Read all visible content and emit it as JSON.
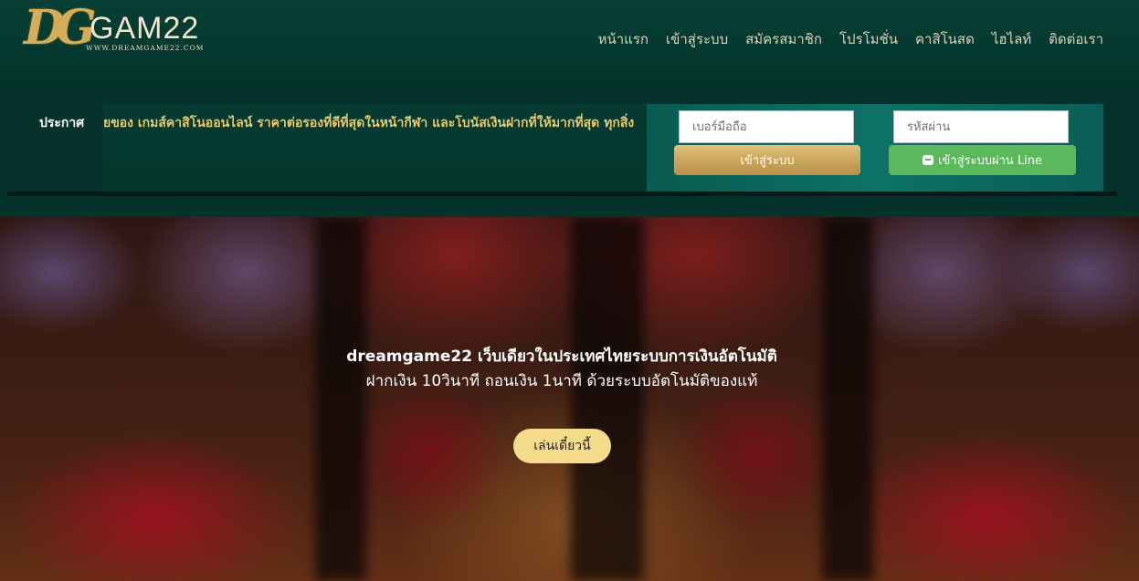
{
  "logo": {
    "monogram": "DG",
    "name": "GAM22",
    "url": "WWW.DREAMGAME22.COM"
  },
  "nav": [
    {
      "label": "หน้าแรก"
    },
    {
      "label": "เข้าสู่ระบบ"
    },
    {
      "label": "สมัครสมาชิก"
    },
    {
      "label": "โปรโมชั่น"
    },
    {
      "label": "คาสิโนสด"
    },
    {
      "label": "ไฮไลท์"
    },
    {
      "label": "ติดต่อเรา"
    }
  ],
  "announcement": {
    "label": "ประกาศ",
    "text": "ยของ เกมส์คาสิโนออนไลน์ ราคาต่อรองที่ดีที่สุดในหน้ากีฬา และโบนัสเงินฝากที่ให้มากที่สุด ทุกสิ่ง"
  },
  "login": {
    "phone_placeholder": "เบอร์มือถือ",
    "password_placeholder": "รหัสผ่าน",
    "login_button": "เข้าสู่ระบบ",
    "line_button": "เข้าสู่ระบบผ่าน Line"
  },
  "hero": {
    "title": "dreamgame22 เว็บเดียวในประเทศไทยระบบการเงินอัตโนมัติ",
    "subtitle": "ฝากเงิน 10วินาที ถอนเงิน 1นาที ด้วยระบบอัตโนมัติของแท้",
    "cta": "เล่นเดี๋ยวนี้"
  },
  "colors": {
    "header_bg": "#05392f",
    "accent_gold": "#c9a45b",
    "line_green": "#5cb85c",
    "cta_bg": "#f4dc8c"
  }
}
